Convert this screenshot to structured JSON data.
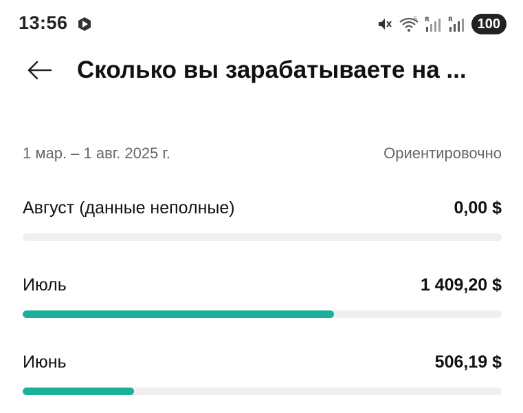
{
  "status_bar": {
    "time": "13:56",
    "battery": "100",
    "icons": [
      "media-app-icon",
      "mute-icon",
      "wifi-icon",
      "signal-roaming-icon",
      "signal-roaming-icon"
    ]
  },
  "header": {
    "title": "Сколько вы зарабатываете на ..."
  },
  "summary": {
    "period": "1 мар. – 1 авг. 2025 г.",
    "note": "Ориентировочно"
  },
  "months": [
    {
      "label": "Август (данные неполные)",
      "amount": "0,00 $",
      "progress": 0.0
    },
    {
      "label": "Июль",
      "amount": "1 409,20 $",
      "progress": 0.65
    },
    {
      "label": "Июнь",
      "amount": "506,19 $",
      "progress": 0.233
    }
  ],
  "colors": {
    "accent": "#1ab09a",
    "track": "#efefef"
  }
}
